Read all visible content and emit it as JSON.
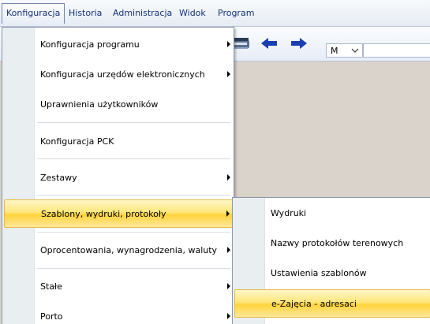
{
  "menubar": {
    "items": [
      {
        "label": "Konfiguracja",
        "active": true
      },
      {
        "label": "Historia"
      },
      {
        "label": "Administracja"
      },
      {
        "label": "Widok"
      },
      {
        "label": "Program"
      }
    ]
  },
  "toolbar": {
    "icons": [
      "scanner-icon",
      "arrow-left-icon",
      "arrow-right-icon"
    ],
    "combo_value": "M",
    "text_value": ""
  },
  "config_menu": {
    "items": [
      {
        "label": "Konfiguracja programu",
        "submenu": true
      },
      {
        "label": "Konfiguracja urzędów elektronicznych",
        "submenu": true
      },
      {
        "label": "Uprawnienia użytkowników",
        "submenu": false
      },
      {
        "label": "Konfiguracja PCK",
        "submenu": false
      },
      {
        "label": "Zestawy",
        "submenu": true
      },
      {
        "label": "Szablony, wydruki, protokoły",
        "submenu": true,
        "highlighted": true
      },
      {
        "label": "Oprocentowania, wynagrodzenia, waluty",
        "submenu": true
      },
      {
        "label": "Stałe",
        "submenu": true
      },
      {
        "label": "Porto",
        "submenu": true
      }
    ]
  },
  "templates_submenu": {
    "items": [
      {
        "label": "Wydruki"
      },
      {
        "label": "Nazwy protokołów terenowych"
      },
      {
        "label": "Ustawienia szablonów"
      },
      {
        "label": "e-Zajęcia - adresaci",
        "highlighted": true
      }
    ]
  },
  "colors": {
    "highlight": "#ffd43c",
    "menu_text": "#15317a",
    "workspace": "#d9d3cb",
    "arrow_blue": "#1a3fb3"
  }
}
